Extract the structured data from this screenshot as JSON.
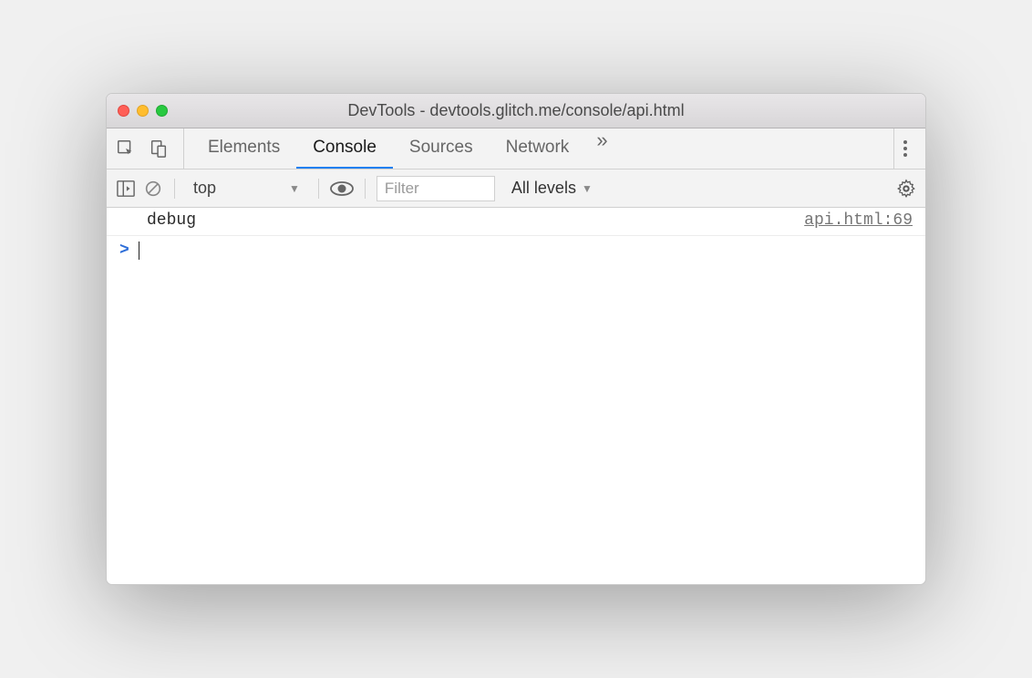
{
  "window": {
    "title": "DevTools - devtools.glitch.me/console/api.html"
  },
  "tabs": {
    "items": [
      "Elements",
      "Console",
      "Sources",
      "Network"
    ],
    "active_index": 1
  },
  "toolbar": {
    "context": "top",
    "filter_placeholder": "Filter",
    "levels_label": "All levels"
  },
  "console": {
    "entries": [
      {
        "message": "debug",
        "source": "api.html:69"
      }
    ],
    "prompt": ">"
  }
}
